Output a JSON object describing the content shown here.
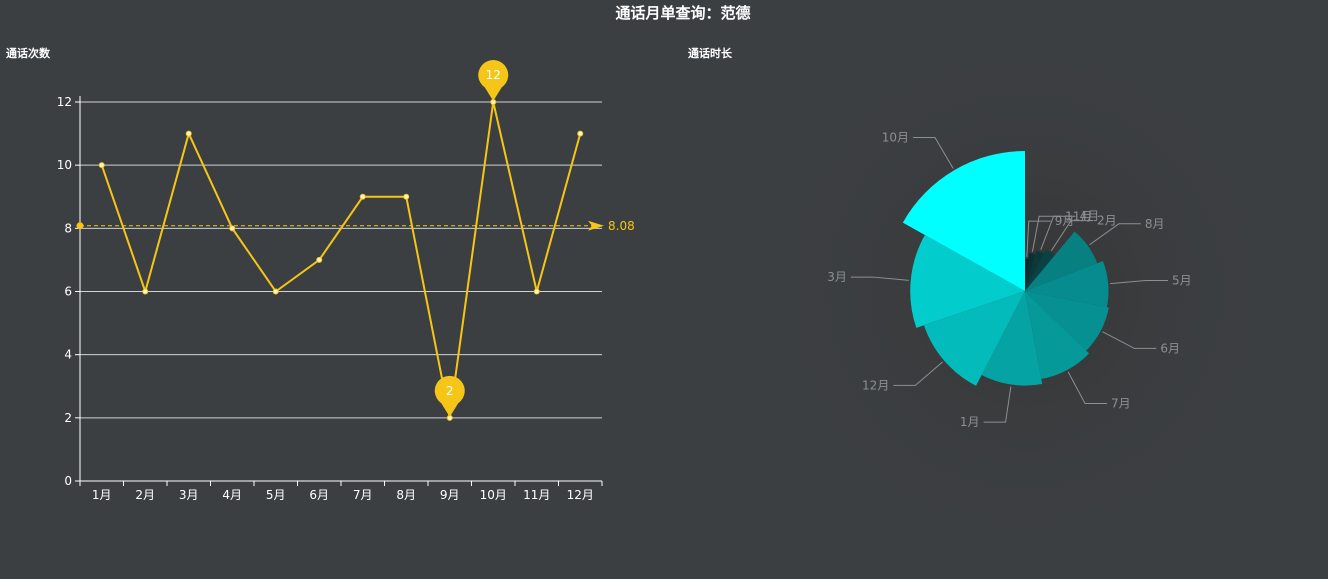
{
  "page": {
    "title": "通话月单查询：范德"
  },
  "chart_data": [
    {
      "type": "line",
      "title": "通话次数",
      "categories": [
        "1月",
        "2月",
        "3月",
        "4月",
        "5月",
        "6月",
        "7月",
        "8月",
        "9月",
        "10月",
        "11月",
        "12月"
      ],
      "series": [
        {
          "values": [
            10,
            6,
            11,
            8,
            6,
            7,
            9,
            9,
            2,
            12,
            6,
            11
          ]
        }
      ],
      "ylim": [
        0,
        12
      ],
      "yticks": [
        0,
        2,
        4,
        6,
        8,
        10,
        12
      ],
      "grid": true,
      "mark_points": [
        {
          "label": "12",
          "category": "10月",
          "value": 12
        },
        {
          "label": "2",
          "category": "9月",
          "value": 2
        }
      ],
      "mark_line": {
        "label": "8.08",
        "value": 8.08,
        "style": "dashed"
      },
      "colors": {
        "line": "#f5c518",
        "marker": "#f5c518",
        "axis": "#ffffff",
        "grid": "#cfd2d6"
      }
    },
    {
      "type": "pie",
      "subtype": "rose",
      "title": "通话时长",
      "slices": [
        {
          "label": "9月",
          "value": 1.2
        },
        {
          "label": "11月",
          "value": 1.8
        },
        {
          "label": "4月",
          "value": 2.2
        },
        {
          "label": "2月",
          "value": 2.6
        },
        {
          "label": "8月",
          "value": 5.7
        },
        {
          "label": "5月",
          "value": 6.3
        },
        {
          "label": "6月",
          "value": 6.5
        },
        {
          "label": "7月",
          "value": 6.9
        },
        {
          "label": "1月",
          "value": 7.4
        },
        {
          "label": "12月",
          "value": 8.6
        },
        {
          "label": "3月",
          "value": 9.4
        },
        {
          "label": "10月",
          "value": 11.9
        }
      ],
      "colors": {
        "low": "#0c2427",
        "high": "#00ffff",
        "label": "#8c8f93"
      }
    }
  ]
}
